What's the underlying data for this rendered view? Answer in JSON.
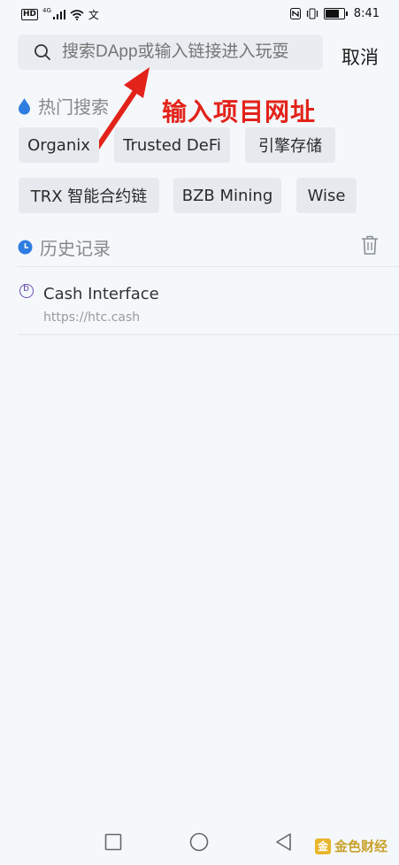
{
  "status_bar": {
    "left_badge": "HD",
    "signal_label": "4G",
    "notification_icon": "文",
    "time": "8:41",
    "icons": [
      "hd-icon",
      "signal-icon",
      "wifi-icon",
      "app-notification-icon",
      "nfc-icon",
      "vibrate-icon",
      "battery-icon"
    ]
  },
  "search": {
    "placeholder": "搜索DApp或输入链接进入玩耍",
    "cancel_label": "取消"
  },
  "annotation": "输入项目网址",
  "hot_search": {
    "title": "热门搜索",
    "tags": [
      "Organix",
      "Trusted DeFi",
      "引擎存储",
      "TRX 智能合约链",
      "BZB Mining",
      "Wise"
    ]
  },
  "history": {
    "title": "历史记录",
    "items": [
      {
        "name": "Cash Interface",
        "url": "https://htc.cash"
      }
    ]
  },
  "watermark": {
    "text": "金色财经",
    "logo_glyph": "金"
  },
  "colors": {
    "background": "#f5f8fb",
    "chip": "#e6eaee",
    "annotation_red": "#e2231a",
    "accent_blue": "#2f7de1"
  }
}
